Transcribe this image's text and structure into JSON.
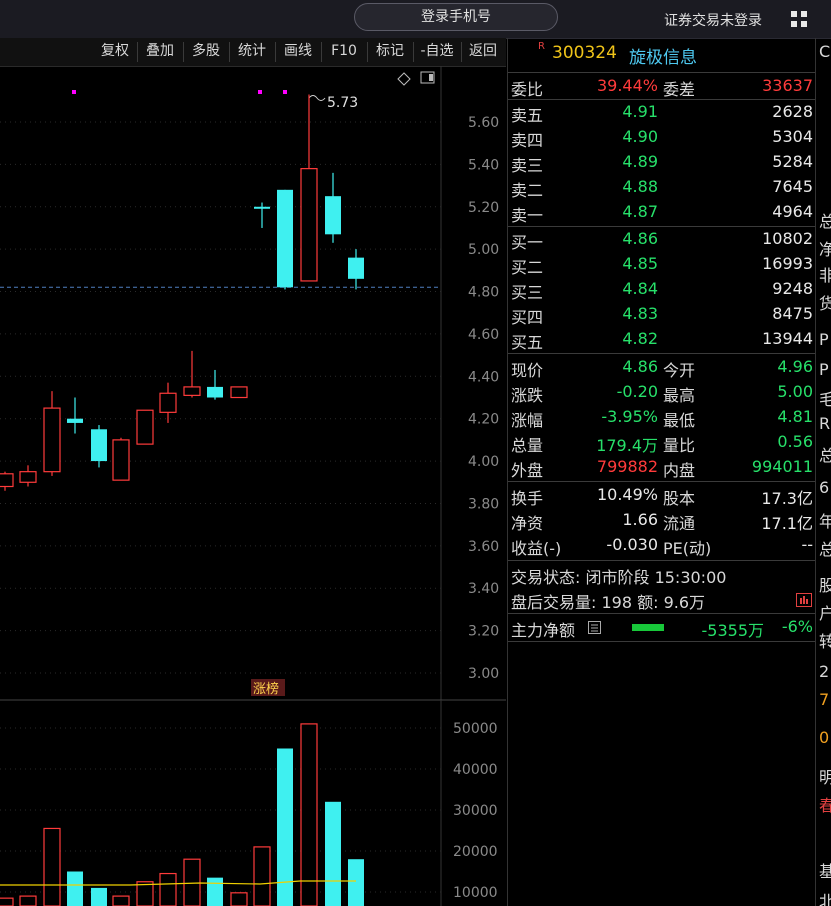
{
  "topbar": {
    "login_button": "登录手机号",
    "login_status": "证券交易未登录"
  },
  "toolbar": {
    "items": [
      "复权",
      "叠加",
      "多股",
      "统计",
      "画线",
      "F10",
      "标记",
      "-自选",
      "返回"
    ]
  },
  "chart": {
    "high_label": "5.73",
    "limit_tag": "涨榜",
    "price_ticks": [
      "5.60",
      "5.40",
      "5.20",
      "5.00",
      "4.80",
      "4.60",
      "4.40",
      "4.20",
      "4.00",
      "3.80",
      "3.60",
      "3.40",
      "3.20",
      "3.00"
    ],
    "volume_ticks": [
      "50000",
      "40000",
      "30000",
      "20000",
      "10000"
    ],
    "colors": {
      "up": "#ff3b3b",
      "down": "#3ff0f0",
      "ma": "#f0d000",
      "marker": "#ff00ff"
    }
  },
  "chart_data": {
    "type": "candlestick",
    "price_axis": [
      3.0,
      5.6
    ],
    "volume_axis": [
      10000,
      50000
    ],
    "candles": [
      {
        "o": 3.88,
        "c": 3.94,
        "h": 3.95,
        "l": 3.86,
        "up": true
      },
      {
        "o": 3.9,
        "c": 3.95,
        "h": 3.98,
        "l": 3.88,
        "up": true
      },
      {
        "o": 3.95,
        "c": 4.25,
        "h": 4.33,
        "l": 3.93,
        "up": true
      },
      {
        "o": 4.2,
        "c": 4.18,
        "h": 4.3,
        "l": 4.13,
        "up": false
      },
      {
        "o": 4.15,
        "c": 4.0,
        "h": 4.17,
        "l": 3.97,
        "up": false
      },
      {
        "o": 3.91,
        "c": 4.1,
        "h": 4.11,
        "l": 3.91,
        "up": true
      },
      {
        "o": 4.08,
        "c": 4.24,
        "h": 4.24,
        "l": 4.08,
        "up": true
      },
      {
        "o": 4.23,
        "c": 4.32,
        "h": 4.37,
        "l": 4.18,
        "up": true
      },
      {
        "o": 4.31,
        "c": 4.35,
        "h": 4.52,
        "l": 4.3,
        "up": true
      },
      {
        "o": 4.35,
        "c": 4.3,
        "h": 4.43,
        "l": 4.29,
        "up": false
      },
      {
        "o": 4.3,
        "c": 4.35,
        "h": 4.35,
        "l": 4.3,
        "up": true
      },
      {
        "o": 5.2,
        "c": 5.2,
        "h": 5.22,
        "l": 5.1,
        "up": false
      },
      {
        "o": 5.28,
        "c": 4.82,
        "h": 5.28,
        "l": 4.81,
        "up": false
      },
      {
        "o": 4.85,
        "c": 5.38,
        "h": 5.73,
        "l": 4.85,
        "up": true
      },
      {
        "o": 5.25,
        "c": 5.07,
        "h": 5.36,
        "l": 5.03,
        "up": false
      },
      {
        "o": 4.96,
        "c": 4.86,
        "h": 5.0,
        "l": 4.81,
        "up": false
      }
    ],
    "volumes": [
      {
        "v": 8500,
        "up": true
      },
      {
        "v": 9000,
        "up": true
      },
      {
        "v": 25500,
        "up": true
      },
      {
        "v": 15000,
        "up": false
      },
      {
        "v": 11000,
        "up": false
      },
      {
        "v": 9000,
        "up": true
      },
      {
        "v": 12500,
        "up": true
      },
      {
        "v": 14500,
        "up": true
      },
      {
        "v": 18000,
        "up": true
      },
      {
        "v": 13500,
        "up": false
      },
      {
        "v": 9800,
        "up": true
      },
      {
        "v": 21000,
        "up": true
      },
      {
        "v": 45000,
        "up": false
      },
      {
        "v": 51000,
        "up": true
      },
      {
        "v": 32000,
        "up": false
      },
      {
        "v": 18000,
        "up": false
      }
    ],
    "price_reference": 4.82
  },
  "quote": {
    "code": "300324",
    "name": "旋极信息",
    "r_mark": "R",
    "weibi_label": "委比",
    "weibi": "39.44%",
    "weicha_label": "委差",
    "weicha": "33637",
    "sells": [
      {
        "label": "卖五",
        "price": "4.91",
        "vol": "2628"
      },
      {
        "label": "卖四",
        "price": "4.90",
        "vol": "5304"
      },
      {
        "label": "卖三",
        "price": "4.89",
        "vol": "5284"
      },
      {
        "label": "卖二",
        "price": "4.88",
        "vol": "7645"
      },
      {
        "label": "卖一",
        "price": "4.87",
        "vol": "4964"
      }
    ],
    "buys": [
      {
        "label": "买一",
        "price": "4.86",
        "vol": "10802"
      },
      {
        "label": "买二",
        "price": "4.85",
        "vol": "16993"
      },
      {
        "label": "买三",
        "price": "4.84",
        "vol": "9248"
      },
      {
        "label": "买四",
        "price": "4.83",
        "vol": "8475"
      },
      {
        "label": "买五",
        "price": "4.82",
        "vol": "13944"
      }
    ],
    "stats1": [
      {
        "l1": "现价",
        "v1": "4.86",
        "c1": "green",
        "l2": "今开",
        "v2": "4.96",
        "c2": "green"
      },
      {
        "l1": "涨跌",
        "v1": "-0.20",
        "c1": "green",
        "l2": "最高",
        "v2": "5.00",
        "c2": "green"
      },
      {
        "l1": "涨幅",
        "v1": "-3.95%",
        "c1": "green",
        "l2": "最低",
        "v2": "4.81",
        "c2": "green"
      },
      {
        "l1": "总量",
        "v1": "179.4万",
        "c1": "green",
        "l2": "量比",
        "v2": "0.56",
        "c2": "green"
      },
      {
        "l1": "外盘",
        "v1": "799882",
        "c1": "red",
        "l2": "内盘",
        "v2": "994011",
        "c2": "green"
      }
    ],
    "stats2": [
      {
        "l1": "换手",
        "v1": "10.49%",
        "l2": "股本",
        "v2": "17.3亿"
      },
      {
        "l1": "净资",
        "v1": "1.66",
        "l2": "流通",
        "v2": "17.1亿"
      },
      {
        "l1": "收益(-)",
        "v1": "-0.030",
        "l2": "PE(动)",
        "v2": "--"
      }
    ],
    "trade_status": "交易状态: 闭市阶段 15:30:00",
    "after_hours": "盘后交易量: 198  额: 9.6万",
    "main_flow_label": "主力净额",
    "main_flow_value": "-5355万",
    "main_flow_pct": "-6%"
  },
  "edge": {
    "chars": [
      "C",
      "总",
      "净",
      "非",
      "货",
      "P",
      "P",
      "毛",
      "R",
      "总",
      "6",
      "年",
      "总",
      "股",
      "户",
      "转",
      "2",
      "7",
      "0",
      "明",
      "春",
      "基",
      "北"
    ]
  }
}
